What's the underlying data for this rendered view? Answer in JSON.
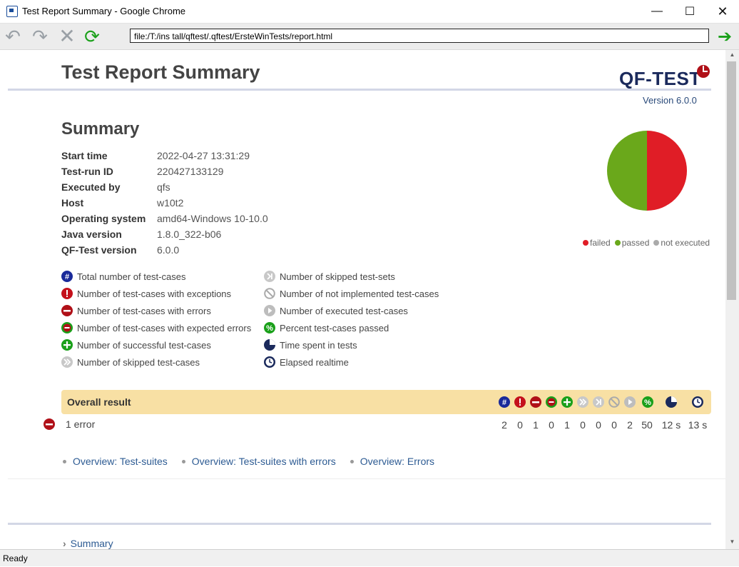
{
  "window": {
    "title": "Test Report Summary - Google Chrome"
  },
  "toolbar": {
    "url": "file:/T:/ins tall/qftest/.qftest/ErsteWinTests/report.html"
  },
  "status": {
    "text": "Ready"
  },
  "header": {
    "title": "Test Report Summary",
    "logo": "QF-TEST",
    "version": "Version 6.0.0"
  },
  "summary": {
    "heading": "Summary",
    "rows": [
      {
        "key": "Start time",
        "value": "2022-04-27 13:31:29"
      },
      {
        "key": "Test-run ID",
        "value": "220427133129"
      },
      {
        "key": "Executed by",
        "value": "qfs"
      },
      {
        "key": "Host",
        "value": "w10t2"
      },
      {
        "key": "Operating system",
        "value": "amd64-Windows 10-10.0"
      },
      {
        "key": "Java version",
        "value": "1.8.0_322-b06"
      },
      {
        "key": "QF-Test version",
        "value": "6.0.0"
      }
    ]
  },
  "chart_data": {
    "type": "pie",
    "slices": [
      {
        "label": "failed",
        "value": 50,
        "color": "#e01d26"
      },
      {
        "label": "passed",
        "value": 50,
        "color": "#6aa81b"
      },
      {
        "label": "not executed",
        "value": 0,
        "color": "#aaaaaa"
      }
    ]
  },
  "legend": {
    "failed": "failed",
    "passed": "passed",
    "not_executed": "not executed"
  },
  "keys": {
    "left": [
      "Total number of test-cases",
      "Number of test-cases with exceptions",
      "Number of test-cases with errors",
      "Number of test-cases with expected errors",
      "Number of successful test-cases",
      "Number of skipped test-cases"
    ],
    "right": [
      "Number of skipped test-sets",
      "Number of not implemented test-cases",
      "Number of executed test-cases",
      "Percent test-cases passed",
      "Time spent in tests",
      "Elapsed realtime"
    ]
  },
  "result": {
    "title": "Overall result",
    "row_label": "1 error",
    "values": [
      "2",
      "0",
      "1",
      "0",
      "1",
      "0",
      "0",
      "0",
      "2",
      "50",
      "12 s",
      "13 s"
    ]
  },
  "links": [
    "Overview: Test-suites",
    "Overview: Test-suites with errors",
    "Overview: Errors"
  ],
  "collapsed": {
    "summary": "Summary"
  },
  "colors": {
    "accent_blue": "#1b2a5c",
    "error_red": "#b01018",
    "success_green": "#1aa01a",
    "result_bar": "#f8e0a4",
    "link": "#2d5b93"
  }
}
